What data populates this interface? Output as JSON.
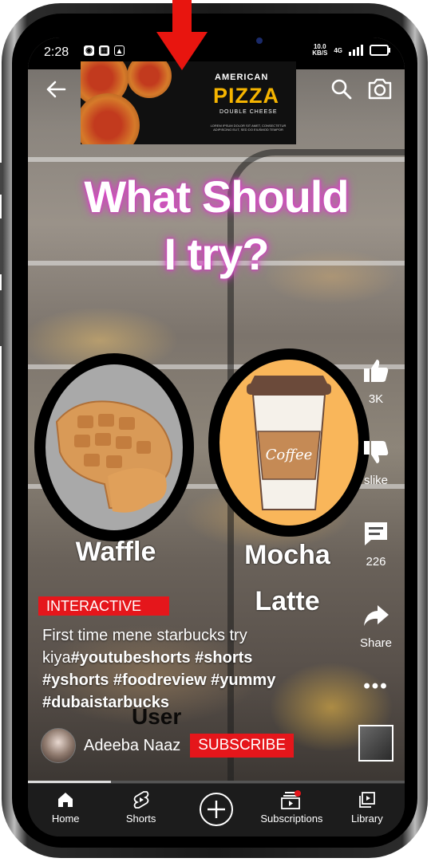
{
  "status_bar": {
    "time": "2:28",
    "net_speed": "10.0\nKB/S",
    "network": "4G"
  },
  "ad": {
    "line1": "AMERICAN",
    "line2": "PIZZA",
    "line3": "DOUBLE CHEESE",
    "fine_print": "LOREM IPSUM DOLOR SIT AMET, CONSECTETUR ADIPISCING ELIT, SED DO EIUSMOD TEMPOR"
  },
  "overlay": {
    "headline_1": "What Should",
    "headline_2": "I try?",
    "option_a": "Waffle",
    "option_b_1": "Mocha",
    "option_b_2": "Latte",
    "coffee_cup_text": "Coffee"
  },
  "rail": {
    "likes": "3K",
    "dislike": "slike",
    "comments": "226",
    "share": "Share"
  },
  "badge": "INTERACTIVE",
  "caption": {
    "plain": "First time mene starbucks try",
    "line2_start": "kiya",
    "tags": "#youtubeshorts #shorts #yshorts #foodreview #yummy #dubaistarbucks"
  },
  "user_overlay": "User",
  "channel": {
    "name": "Adeeba Naaz",
    "subscribe": "SUBSCRIBE"
  },
  "progress": 0.22,
  "nav": {
    "home": "Home",
    "shorts": "Shorts",
    "subscriptions": "Subscriptions",
    "library": "Library"
  },
  "colors": {
    "accent_red": "#e5161b",
    "nav_bg": "#1c1c1c",
    "headline_glow": "#d93cc6"
  }
}
